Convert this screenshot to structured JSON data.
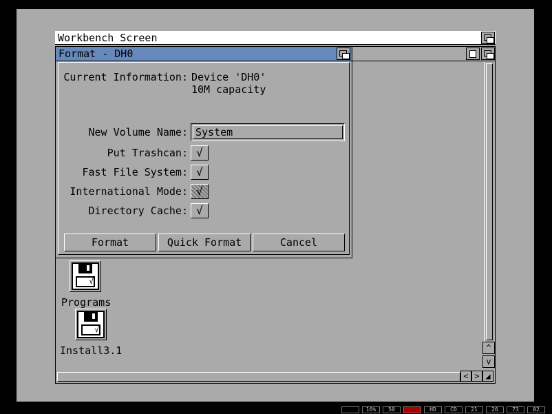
{
  "screen_title": "Workbench Screen",
  "format_window": {
    "title": "Format - DH0",
    "current_info_label": "Current Information:",
    "device_line": "Device 'DH0'",
    "capacity_line": "10M capacity",
    "volume_name_label": "New Volume Name:",
    "volume_name_value": "System",
    "options": [
      {
        "label": "Put Trashcan:",
        "checked": "√"
      },
      {
        "label": "Fast File System:",
        "checked": "√"
      },
      {
        "label": "International Mode:",
        "checked": "√"
      },
      {
        "label": "Directory Cache:",
        "checked": "√"
      }
    ],
    "buttons": {
      "format": "Format",
      "quick_format": "Quick Format",
      "cancel": "Cancel"
    }
  },
  "drawer_icons": [
    {
      "name": "Programs"
    },
    {
      "name": "Install3.1"
    }
  ],
  "scroll_arrows": {
    "up": "^",
    "down": "v",
    "left": "<",
    "right": ">"
  },
  "status_bar": [
    "16%",
    "50",
    "",
    "HD",
    "CD",
    "21",
    "26",
    "73",
    "02"
  ],
  "colors": {
    "active_title": "#6688bb",
    "background": "#aaaaaa",
    "power_led": "#aa0000"
  }
}
